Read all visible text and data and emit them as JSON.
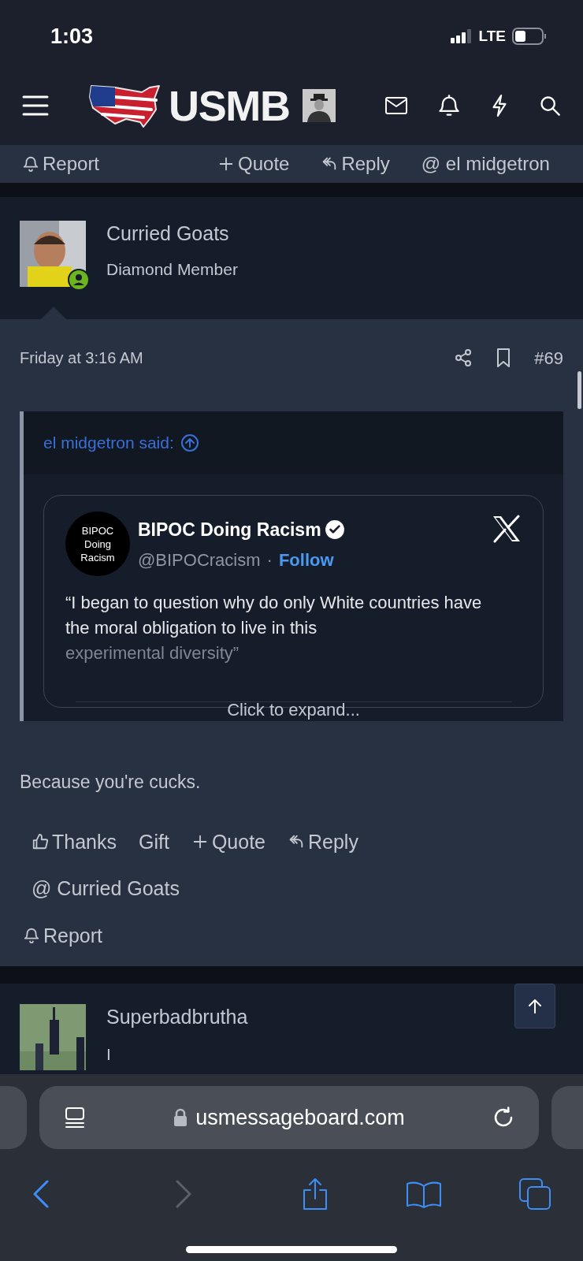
{
  "status_bar": {
    "time": "1:03",
    "network": "LTE"
  },
  "header": {
    "logo_text": "USMB"
  },
  "previous_post_actions": [
    {
      "kind": "report",
      "label": "Report"
    },
    {
      "kind": "quote",
      "label": "Quote"
    },
    {
      "kind": "reply",
      "label": "Reply"
    },
    {
      "kind": "mention",
      "label": "@ el midgetron"
    }
  ],
  "post": {
    "author": "Curried Goats",
    "user_title": "Diamond Member",
    "online": true,
    "date": "Friday at 3:16 AM",
    "number": "#69",
    "quote": {
      "author_line": "el midgetron said:",
      "embed": {
        "avatar_text": "BIPOC Doing Racism",
        "name": "BIPOC Doing Racism",
        "verified": true,
        "handle": "@BIPOCracism",
        "separator": "·",
        "follow": "Follow",
        "text": "“I began to question why do only White countries have the moral obligation to live in this",
        "faded_text": "experimental diversity”"
      },
      "expand": "Click to expand..."
    },
    "body": "Because you're cucks.",
    "actions": [
      {
        "kind": "thanks",
        "label": "Thanks"
      },
      {
        "kind": "gift",
        "label": "Gift"
      },
      {
        "kind": "quote",
        "label": "Quote"
      },
      {
        "kind": "reply",
        "label": "Reply"
      },
      {
        "kind": "mention",
        "label": "@ Curried Goats"
      },
      {
        "kind": "report",
        "label": "Report"
      }
    ]
  },
  "next_post": {
    "author": "Superbadbrutha",
    "user_title": "I"
  },
  "browser": {
    "url": "usmessageboard.com",
    "back_disabled": false,
    "forward_disabled": true
  }
}
